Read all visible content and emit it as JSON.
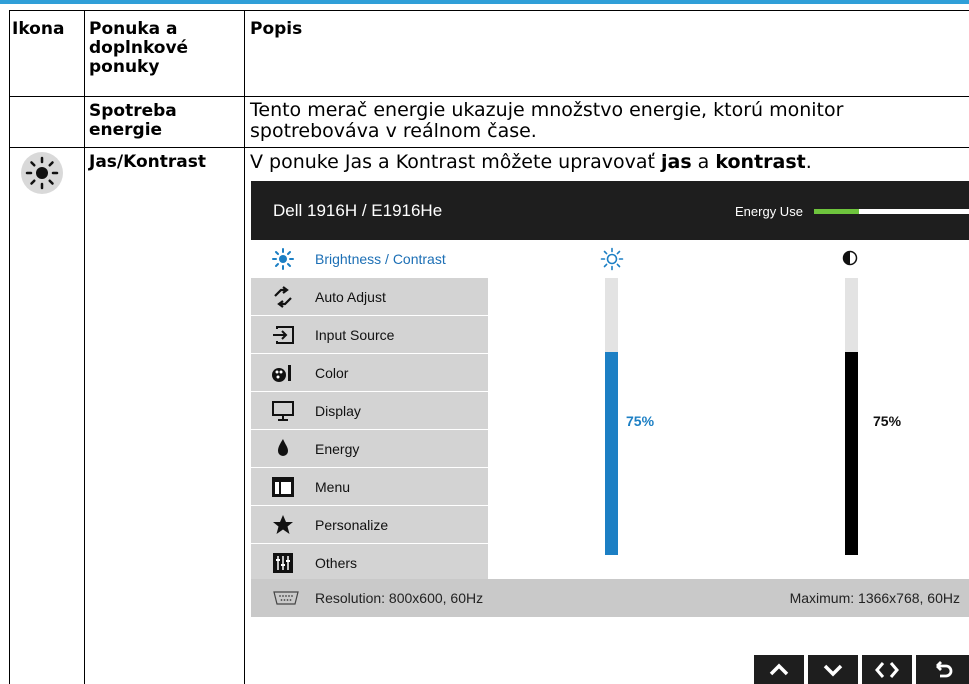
{
  "table": {
    "headers": {
      "icon": "Ikona",
      "menu": [
        "Ponuka a",
        "doplnkové",
        "ponuky"
      ],
      "description": "Popis"
    },
    "rows": [
      {
        "menu": [
          "Spotreba",
          "energie"
        ],
        "description": [
          "Tento merač energie ukazuje množstvo energie, ktorú monitor",
          "spotrebováva v reálnom čase."
        ]
      },
      {
        "icon": "sun-icon",
        "menu": [
          "Jas/Kontrast"
        ],
        "description_parts": {
          "pre": "V ponuke Jas a Kontrast môžete upravovať ",
          "b1": "jas",
          "mid": " a ",
          "b2": "kontrast",
          "post": "."
        }
      }
    ]
  },
  "osd": {
    "title": "Dell 1916H / E1916He",
    "energy_label": "Energy Use",
    "energy_level": 0.5,
    "menu_items": [
      {
        "label": "Brightness / Contrast",
        "icon": "brightness-icon",
        "active": true
      },
      {
        "label": "Auto Adjust",
        "icon": "auto-adjust-icon"
      },
      {
        "label": "Input Source",
        "icon": "input-source-icon"
      },
      {
        "label": "Color",
        "icon": "color-icon"
      },
      {
        "label": "Display",
        "icon": "display-icon"
      },
      {
        "label": "Energy",
        "icon": "energy-icon"
      },
      {
        "label": "Menu",
        "icon": "menu-icon"
      },
      {
        "label": "Personalize",
        "icon": "star-icon"
      },
      {
        "label": "Others",
        "icon": "others-icon"
      }
    ],
    "brightness": {
      "value": "75%",
      "level": 0.75,
      "color": "#1c7fc4",
      "icon": "brightness-icon"
    },
    "contrast": {
      "value": "75%",
      "level": 0.75,
      "color": "#000000",
      "icon": "contrast-icon"
    },
    "resolution_text": "Resolution: 800x600, 60Hz",
    "maximum_text": "Maximum: 1366x768, 60Hz",
    "nav_buttons": [
      "up-arrow-icon",
      "down-arrow-icon",
      "left-right-icon",
      "back-icon"
    ]
  },
  "colors": {
    "accent": "#2f9fd8",
    "energy": "#6ec43d",
    "osd_dark": "#1e1e1e"
  }
}
